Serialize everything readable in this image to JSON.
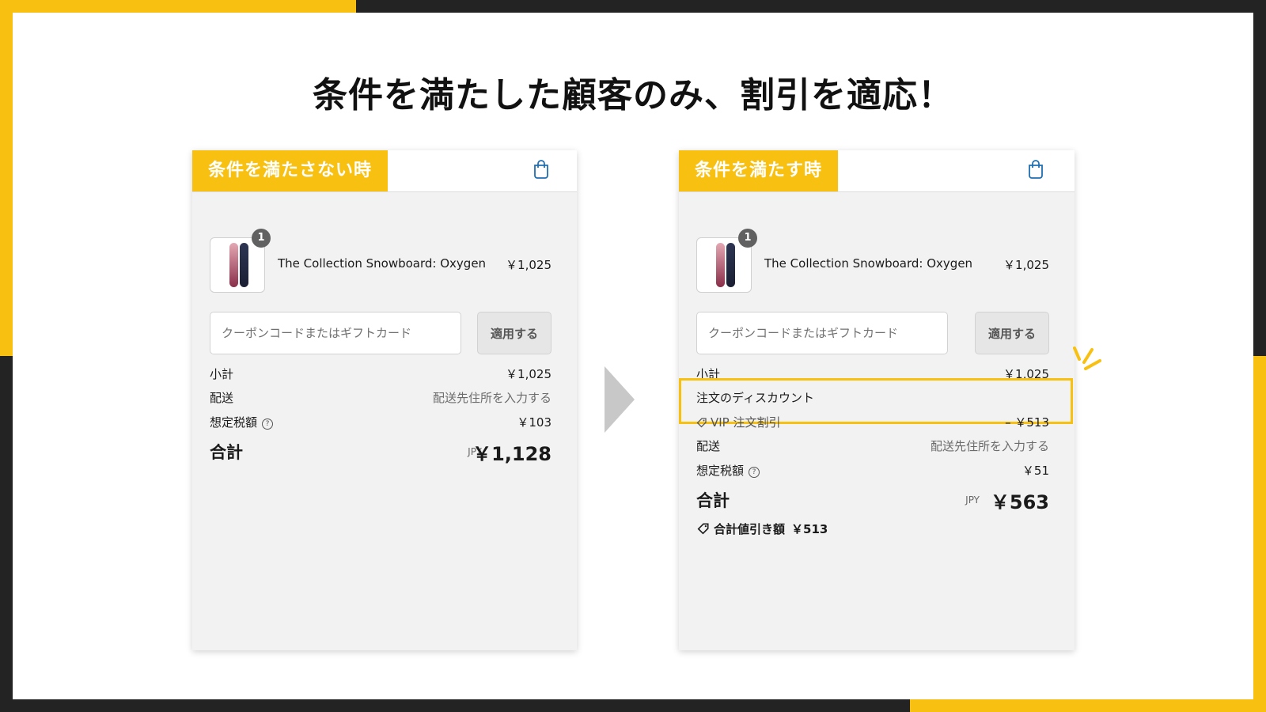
{
  "title": "条件を満たした顧客のみ、割引を適応！",
  "colors": {
    "accent": "#f8c011",
    "frame": "#232323",
    "panel_bg": "#f2f2f2"
  },
  "left_panel": {
    "tag": "条件を満たさない時",
    "cart_icon": "shopping-bag-icon",
    "item": {
      "quantity": "1",
      "name": "The Collection Snowboard: Oxygen",
      "price": "￥1,025"
    },
    "coupon": {
      "placeholder": "クーポンコードまたはギフトカード",
      "apply_label": "適用する"
    },
    "subtotal": {
      "label": "小計",
      "value": "￥1,025"
    },
    "shipping": {
      "label": "配送",
      "value": "配送先住所を入力する"
    },
    "tax": {
      "label": "想定税額",
      "value": "￥103"
    },
    "total": {
      "label": "合計",
      "currency": "JPY",
      "value": "￥1,128"
    }
  },
  "right_panel": {
    "tag": "条件を満たす時",
    "cart_icon": "shopping-bag-icon",
    "item": {
      "quantity": "1",
      "name": "The Collection Snowboard: Oxygen",
      "price": "￥1,025"
    },
    "coupon": {
      "placeholder": "クーポンコードまたはギフトカード",
      "apply_label": "適用する"
    },
    "subtotal": {
      "label": "小計",
      "value": "￥1,025"
    },
    "discount": {
      "label": "注文のディスカウント",
      "name": "VIP 注文割引",
      "value": "– ￥513"
    },
    "shipping": {
      "label": "配送",
      "value": "配送先住所を入力する"
    },
    "tax": {
      "label": "想定税額",
      "value": "￥51"
    },
    "total": {
      "label": "合計",
      "currency": "JPY",
      "value": "￥563"
    },
    "savings": {
      "label": "合計値引き額",
      "value": "￥513"
    }
  }
}
